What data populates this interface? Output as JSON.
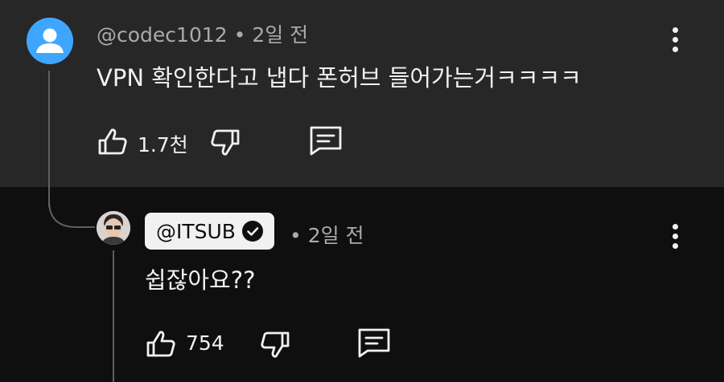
{
  "comment": {
    "author": "@codec1012",
    "time": "2일 전",
    "text": "VPN 확인한다고 냅다 폰허브 들어가는거ㅋㅋㅋㅋ",
    "likes": "1.7천"
  },
  "reply": {
    "author": "@ITSUB",
    "time": "2일 전",
    "text": "쉽잖아요??",
    "likes": "754"
  },
  "separator": "•",
  "colors": {
    "top_bg": "#272727",
    "bottom_bg": "#0f0f0f",
    "avatar_blue": "#3ea6ff",
    "text": "#f1f1f1",
    "meta": "#aaaaaa"
  },
  "icons": [
    "person-icon",
    "thumbs-up-icon",
    "thumbs-down-icon",
    "reply-icon",
    "more-vert-icon",
    "verified-check-icon"
  ]
}
